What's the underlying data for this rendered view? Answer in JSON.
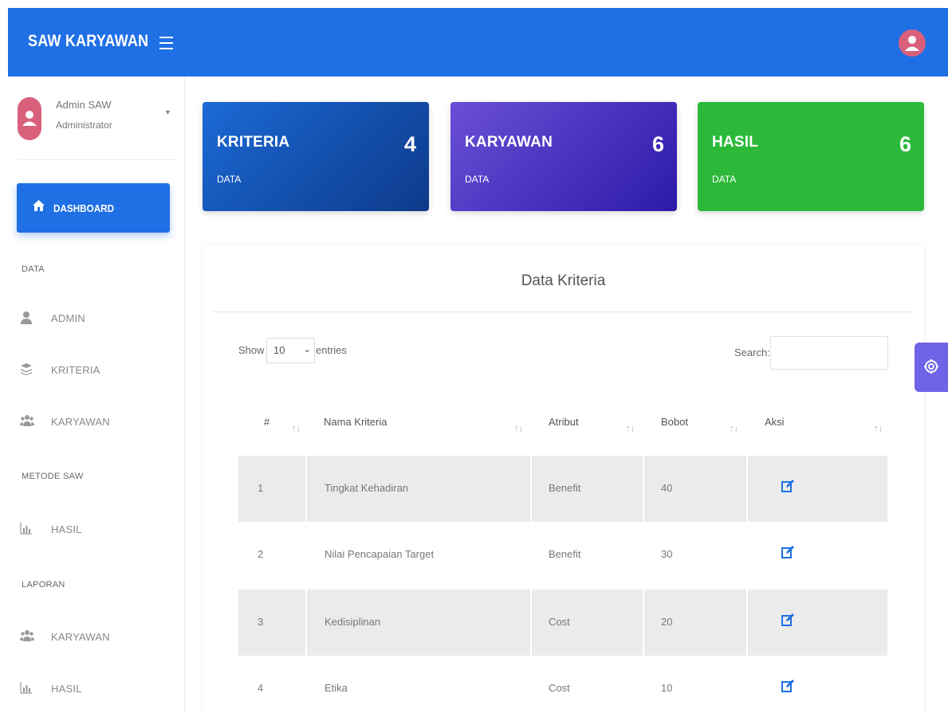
{
  "header": {
    "brand": "SAW KARYAWAN"
  },
  "sidebar": {
    "user": {
      "name": "Admin SAW",
      "role": "Administrator"
    },
    "active_item": {
      "label": "DASHBOARD",
      "icon": "home-icon"
    },
    "sections": [
      {
        "label": "DATA",
        "items": [
          {
            "label": "ADMIN",
            "icon": "user-icon"
          },
          {
            "label": "KRITERIA",
            "icon": "layers-icon"
          },
          {
            "label": "KARYAWAN",
            "icon": "users-icon"
          }
        ]
      },
      {
        "label": "METODE SAW",
        "items": [
          {
            "label": "HASIL",
            "icon": "bar-chart-icon"
          }
        ]
      },
      {
        "label": "LAPORAN",
        "items": [
          {
            "label": "KARYAWAN",
            "icon": "users-icon"
          },
          {
            "label": "HASIL",
            "icon": "bar-chart-icon"
          }
        ]
      }
    ]
  },
  "cards": [
    {
      "title": "KRITERIA",
      "sub": "DATA",
      "count": "4",
      "color": "#1c6ad6"
    },
    {
      "title": "KARYAWAN",
      "sub": "DATA",
      "count": "6",
      "color": "#4a35c2"
    },
    {
      "title": "HASIL",
      "sub": "DATA",
      "count": "6",
      "color": "#2cb93a"
    }
  ],
  "panel": {
    "title": "Data Kriteria",
    "show_label": "Show",
    "length_value": "10",
    "entries_label": "entries",
    "search_label": "Search:",
    "search_value": "",
    "columns": [
      "#",
      "Nama Kriteria",
      "Atribut",
      "Bobot",
      "Aksi"
    ],
    "rows": [
      {
        "no": "1",
        "nama": "Tingkat Kehadiran",
        "atribut": "Benefit",
        "bobot": "40"
      },
      {
        "no": "2",
        "nama": "Nilai Pencapaian Target",
        "atribut": "Benefit",
        "bobot": "30"
      },
      {
        "no": "3",
        "nama": "Kedisiplinan",
        "atribut": "Cost",
        "bobot": "20"
      },
      {
        "no": "4",
        "nama": "Etika",
        "atribut": "Cost",
        "bobot": "10"
      }
    ]
  },
  "colors": {
    "primary": "#1f6fe5",
    "edit_icon": "#1f6fe5",
    "settings": "#6f64e7"
  }
}
